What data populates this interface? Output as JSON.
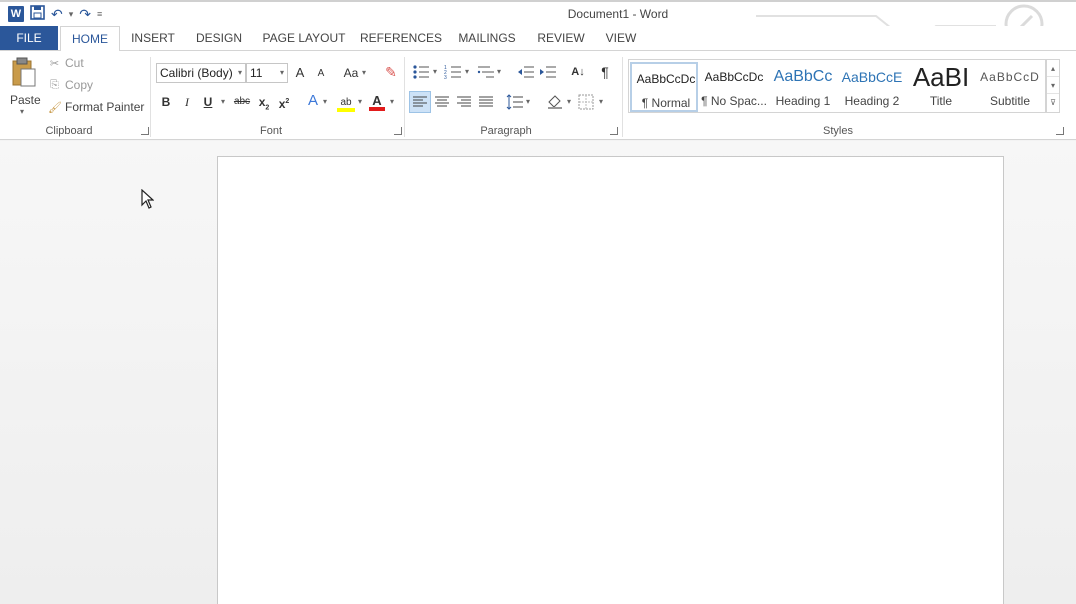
{
  "window": {
    "title": "Document1 - Word"
  },
  "qat": {
    "logo": "W",
    "save_icon": "save-icon",
    "undo_icon": "undo-icon",
    "redo_icon": "redo-icon"
  },
  "tabs": [
    {
      "label": "FILE"
    },
    {
      "label": "HOME"
    },
    {
      "label": "INSERT"
    },
    {
      "label": "DESIGN"
    },
    {
      "label": "PAGE LAYOUT"
    },
    {
      "label": "REFERENCES"
    },
    {
      "label": "MAILINGS"
    },
    {
      "label": "REVIEW"
    },
    {
      "label": "VIEW"
    }
  ],
  "active_tab": "HOME",
  "clipboard": {
    "paste": "Paste",
    "cut": "Cut",
    "copy": "Copy",
    "format_painter": "Format Painter",
    "group_label": "Clipboard"
  },
  "font": {
    "family": "Calibri (Body)",
    "size": "11",
    "grow": "A",
    "shrink": "A",
    "change_case": "Aa",
    "bold": "B",
    "italic": "I",
    "underline": "U",
    "strike": "abc",
    "subscript": "x",
    "superscript": "x",
    "text_effects": "A",
    "font_color": "A",
    "group_label": "Font"
  },
  "paragraph": {
    "show_marks": "¶",
    "sort": "A↓",
    "group_label": "Paragraph"
  },
  "styles": {
    "group_label": "Styles",
    "items": [
      {
        "sample": "AaBbCcDc",
        "name": "¶ Normal",
        "selected": true
      },
      {
        "sample": "AaBbCcDc",
        "name": "¶ No Spac..."
      },
      {
        "sample": "AaBbCc",
        "name": "Heading 1"
      },
      {
        "sample": "AaBbCcE",
        "name": "Heading 2"
      },
      {
        "sample": "AaBI",
        "name": "Title"
      },
      {
        "sample": "AaBbCcD",
        "name": "Subtitle"
      }
    ]
  },
  "colors": {
    "accent": "#2b579a",
    "highlight": "#ffff00",
    "font_color": "#e21b1b",
    "heading_blue": "#2e74b5"
  }
}
